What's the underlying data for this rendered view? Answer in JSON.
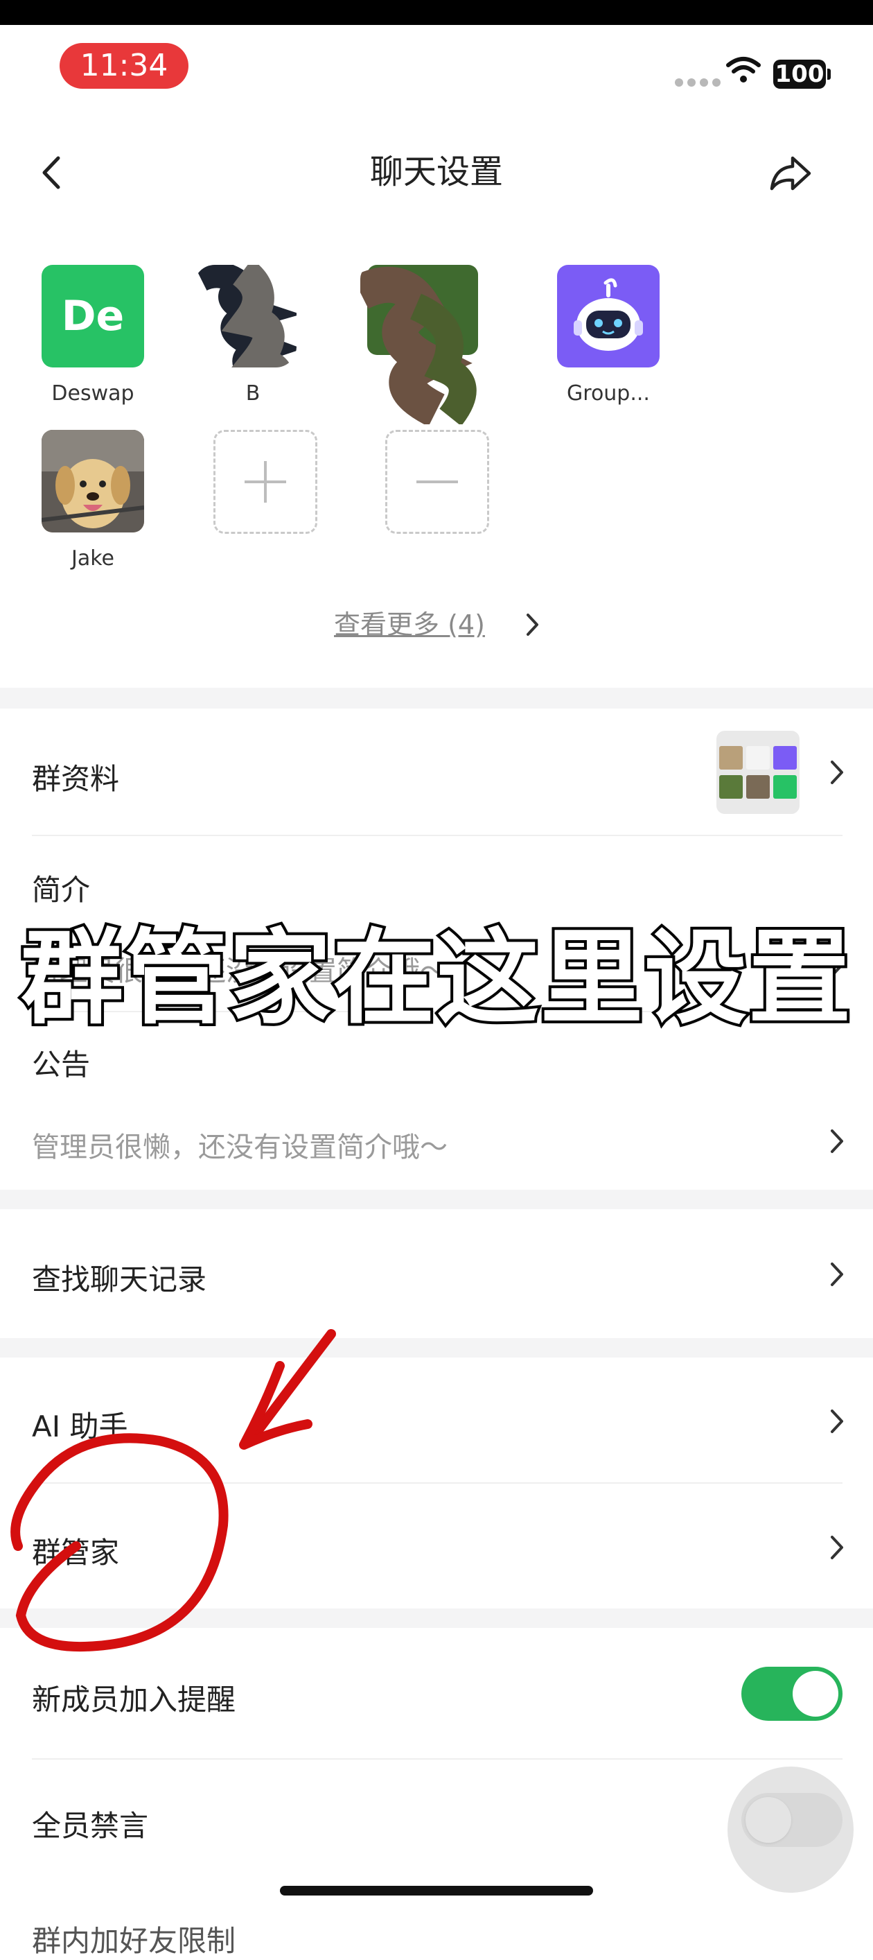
{
  "status_bar": {
    "time": "11:34",
    "battery": "100",
    "time_pill_color": "#e8383a"
  },
  "nav": {
    "title": "聊天设置",
    "back_icon": "chevron-left-icon",
    "share_icon": "share-icon"
  },
  "members": {
    "items": [
      {
        "label": "Deswap",
        "avatar_text": "De",
        "avatar_color": "#27c265"
      },
      {
        "label": "B",
        "avatar_text": "",
        "avatar_color": "#6a6a6a"
      },
      {
        "label": "",
        "avatar_text": "",
        "avatar_color": "#4f6a3a"
      },
      {
        "label": "Group...",
        "avatar_text": "",
        "avatar_color": "#7b5cf5"
      },
      {
        "label": "Jake",
        "avatar_text": "",
        "avatar_color": "#b9a07a"
      }
    ],
    "add_icon": "plus-icon",
    "remove_icon": "minus-icon",
    "see_more": "查看更多 (4)"
  },
  "settings": {
    "group_profile": "群资料",
    "intro_title": "简介",
    "intro_value": "管理员很懒，还没有设置简介哦～",
    "notice_title": "公告",
    "notice_value": "管理员很懒，还没有设置简介哦～",
    "search_history": "查找聊天记录",
    "ai_assistant": "AI 助手",
    "group_butler": "群管家",
    "new_member_alert": "新成员加入提醒",
    "new_member_alert_on": true,
    "mute_all": "全员禁言",
    "mute_all_on": false,
    "next_row_partial": "群内加好友限制"
  },
  "annotation": {
    "overlay_text": "群管家在这里设置",
    "arrow_color": "#d40f0f"
  },
  "accent_color": "#27b45b"
}
